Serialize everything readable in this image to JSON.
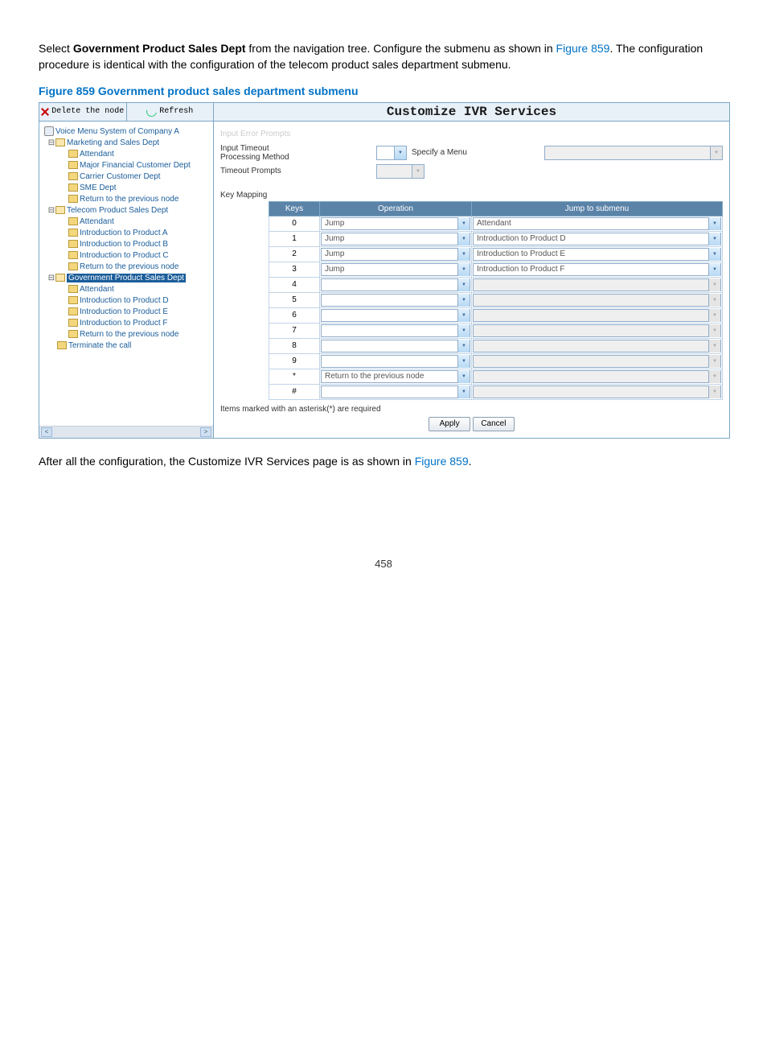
{
  "intro": {
    "pre": "Select ",
    "dept_bold": "Government Product Sales Dept",
    "mid": " from the navigation tree. Configure the submenu as shown in ",
    "fig_ref": "Figure 859",
    "post": ". The configuration procedure is identical with the configuration of the telecom product sales department submenu."
  },
  "figure_caption": "Figure 859 Government product sales department submenu",
  "toolbar": {
    "delete_label": "Delete the node",
    "refresh_label": "Refresh",
    "title": "Customize IVR Services"
  },
  "tree": {
    "root": "Voice Menu System of Company A",
    "n1": "Marketing and Sales Dept",
    "n1a": "Attendant",
    "n1b": "Major Financial Customer Dept",
    "n1c": "Carrier Customer Dept",
    "n1d": "SME Dept",
    "n1e": "Return to the previous node",
    "n2": "Telecom Product Sales Dept",
    "n2a": "Attendant",
    "n2b": "Introduction to Product A",
    "n2c": "Introduction to Product B",
    "n2d": "Introduction to Product C",
    "n2e": "Return to the previous node",
    "n3": "Government Product Sales Dept",
    "n3a": "Attendant",
    "n3b": "Introduction to Product D",
    "n3c": "Introduction to Product E",
    "n3d": "Introduction to Product F",
    "n3e": "Return to the previous node",
    "n4": "Terminate the call"
  },
  "form": {
    "input_error_label": "Input Error Prompts",
    "timeout_method_label": "Input Timeout\nProcessing Method",
    "timeout_method_side": "Specify a Menu",
    "timeout_prompts_label": "Timeout Prompts",
    "key_mapping_label": "Key Mapping"
  },
  "key_table": {
    "h_keys": "Keys",
    "h_op": "Operation",
    "h_jump": "Jump to submenu",
    "rows": [
      {
        "key": "0",
        "op": "Jump",
        "jump": "Attendant",
        "enabled": true
      },
      {
        "key": "1",
        "op": "Jump",
        "jump": "Introduction to Product D",
        "enabled": true
      },
      {
        "key": "2",
        "op": "Jump",
        "jump": "Introduction to Product E",
        "enabled": true
      },
      {
        "key": "3",
        "op": "Jump",
        "jump": "Introduction to Product F",
        "enabled": true
      },
      {
        "key": "4",
        "op": "",
        "jump": "",
        "enabled": false
      },
      {
        "key": "5",
        "op": "",
        "jump": "",
        "enabled": false
      },
      {
        "key": "6",
        "op": "",
        "jump": "",
        "enabled": false
      },
      {
        "key": "7",
        "op": "",
        "jump": "",
        "enabled": false
      },
      {
        "key": "8",
        "op": "",
        "jump": "",
        "enabled": false
      },
      {
        "key": "9",
        "op": "",
        "jump": "",
        "enabled": false
      },
      {
        "key": "*",
        "op": "Return to the previous node",
        "jump": "",
        "enabled": false
      },
      {
        "key": "#",
        "op": "",
        "jump": "",
        "enabled": false
      }
    ]
  },
  "footnote": "Items marked with an asterisk(*) are required",
  "buttons": {
    "apply": "Apply",
    "cancel": "Cancel"
  },
  "outro": {
    "pre": "After all the configuration, the Customize IVR Services page is as shown in ",
    "fig_ref": "Figure 859",
    "post": "."
  },
  "page_number": "458"
}
